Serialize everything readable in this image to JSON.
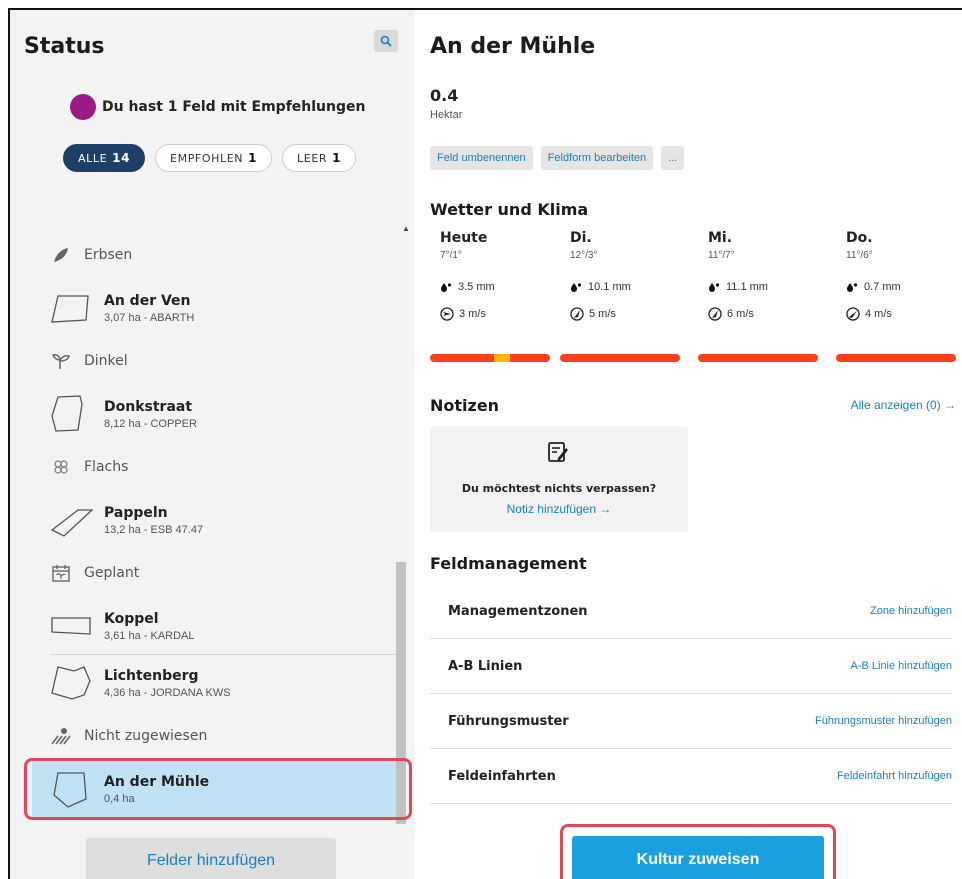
{
  "left": {
    "title": "Status",
    "search_icon": "search-icon",
    "recommendation_text": "Du hast 1 Feld mit Empfehlungen",
    "recommendation_color": "#9b1a86",
    "chips": [
      {
        "label": "ALLE",
        "count": "14",
        "active": true
      },
      {
        "label": "EMPFOHLEN",
        "count": "1",
        "active": false
      },
      {
        "label": "LEER",
        "count": "1",
        "active": false
      }
    ],
    "categories": {
      "erbsen": "Erbsen",
      "dinkel": "Dinkel",
      "flachs": "Flachs",
      "geplant": "Geplant",
      "nicht_zugewiesen": "Nicht zugewiesen"
    },
    "fields": {
      "an_der_ven": {
        "name": "An der Ven",
        "sub": "3,07 ha - ABARTH"
      },
      "donkstraat": {
        "name": "Donkstraat",
        "sub": "8,12 ha - COPPER"
      },
      "pappeln": {
        "name": "Pappeln",
        "sub": "13,2 ha - ESB 47.47"
      },
      "koppel": {
        "name": "Koppel",
        "sub": "3,61 ha - KARDAL"
      },
      "lichtenberg": {
        "name": "Lichtenberg",
        "sub": "4,36 ha - JORDANA KWS"
      },
      "an_der_muehle": {
        "name": "An der Mühle",
        "sub": "0,4 ha"
      }
    },
    "add_fields_label": "Felder hinzufügen"
  },
  "right": {
    "title": "An der Mühle",
    "area_value": "0.4",
    "area_unit": "Hektar",
    "actions": [
      "Feld umbenennen",
      "Feldform bearbeiten",
      "..."
    ],
    "weather_title": "Wetter und Klima",
    "days": [
      {
        "name": "Heute",
        "temp": "7°/1°",
        "rain": "3.5 mm",
        "wind": "3 m/s"
      },
      {
        "name": "Di.",
        "temp": "12°/3°",
        "rain": "10.1 mm",
        "wind": "5 m/s"
      },
      {
        "name": "Mi.",
        "temp": "11°/7°",
        "rain": "11.1 mm",
        "wind": "6 m/s"
      },
      {
        "name": "Do.",
        "temp": "11°/6°",
        "rain": "0.7 mm",
        "wind": "4 m/s"
      }
    ],
    "bar_colors": {
      "main": "#ff3d1f",
      "highlight": "#ffb700"
    },
    "notes_title": "Notizen",
    "notes_all": "Alle anzeigen (0) →",
    "notes_question": "Du möchtest nichts verpassen?",
    "notes_add": "Notiz hinzufügen →",
    "fm_title": "Feldmanagement",
    "fm_rows": [
      {
        "label": "Managementzonen",
        "link": "Zone hinzufügen"
      },
      {
        "label": "A-B Linien",
        "link": "A-B Linie hinzufügen"
      },
      {
        "label": "Führungsmuster",
        "link": "Führungsmuster hinzufügen"
      },
      {
        "label": "Feldeinfahrten",
        "link": "Feldeinfahrt hinzufügen"
      }
    ],
    "assign_label": "Kultur zuweisen"
  }
}
